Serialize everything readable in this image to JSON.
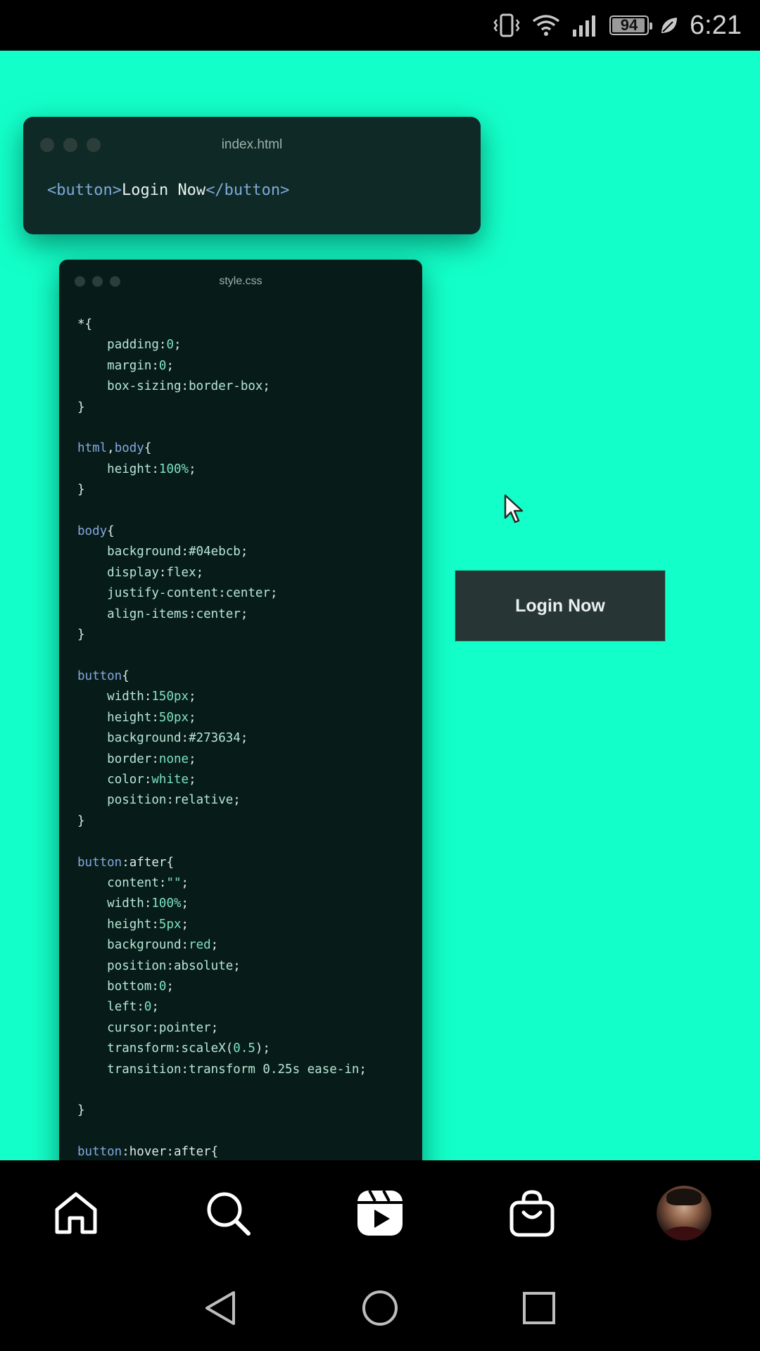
{
  "status_bar": {
    "battery": "94",
    "time": "6:21",
    "icons": [
      "vibrate-icon",
      "wifi-icon",
      "signal-icon",
      "battery-icon",
      "leaf-icon"
    ]
  },
  "video": {
    "background_color": "#13ffc9",
    "html_window": {
      "title": "index.html",
      "open_tag": "<button>",
      "text": "Login Now",
      "close_tag": "</button>"
    },
    "css_window": {
      "title": "style.css"
    },
    "preview_button": {
      "label": "Login Now",
      "color": "#273634"
    }
  },
  "bottom_nav": {
    "items": [
      "home-icon",
      "search-icon",
      "reels-icon",
      "shop-icon",
      "profile-avatar"
    ]
  },
  "system_nav": {
    "items": [
      "back-icon",
      "home-circle-icon",
      "recents-icon"
    ]
  }
}
